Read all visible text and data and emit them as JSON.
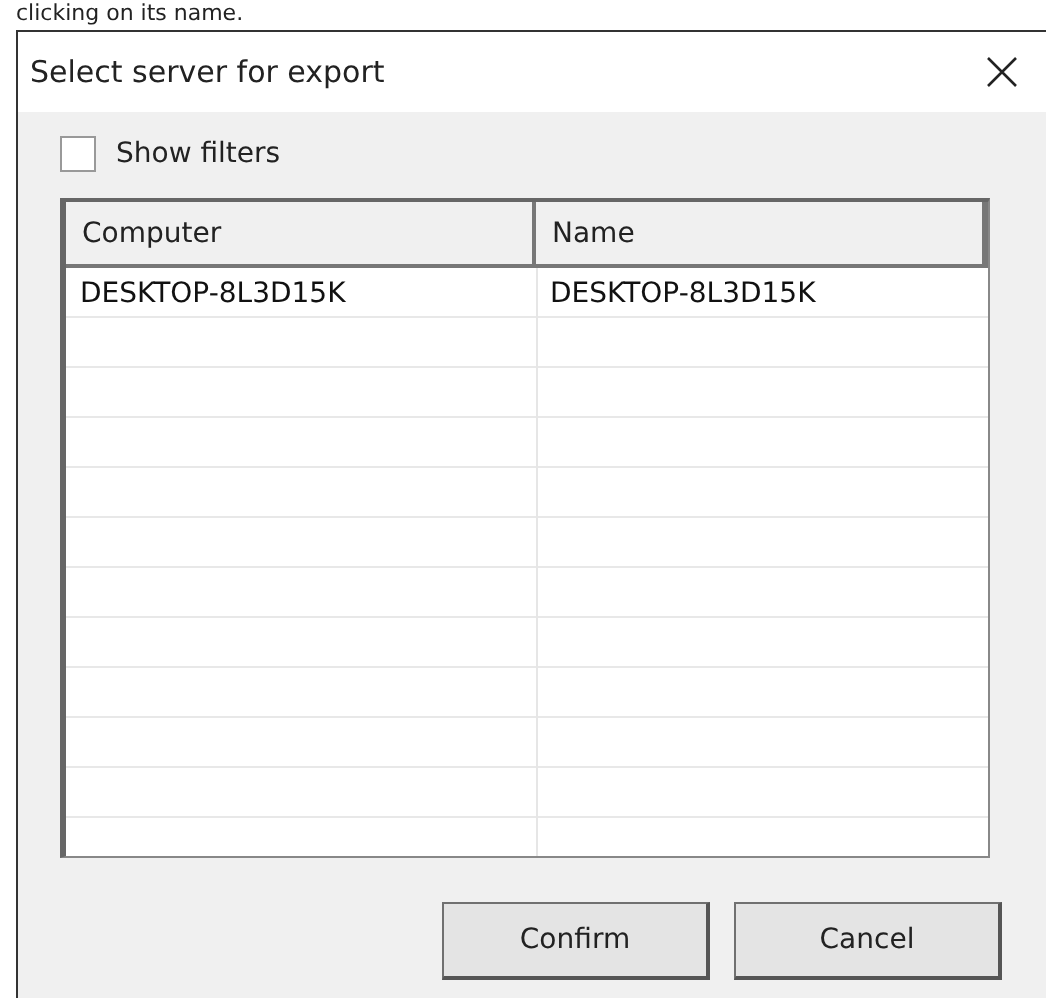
{
  "caption": "clicking on its name.",
  "window": {
    "title": "Select server for export"
  },
  "show_filters": {
    "label": "Show filters",
    "checked": false
  },
  "table": {
    "columns": [
      "Computer",
      "Name"
    ],
    "rows": [
      [
        "DESKTOP-8L3D15K",
        "DESKTOP-8L3D15K"
      ]
    ]
  },
  "buttons": [
    "Confirm",
    "Cancel"
  ]
}
